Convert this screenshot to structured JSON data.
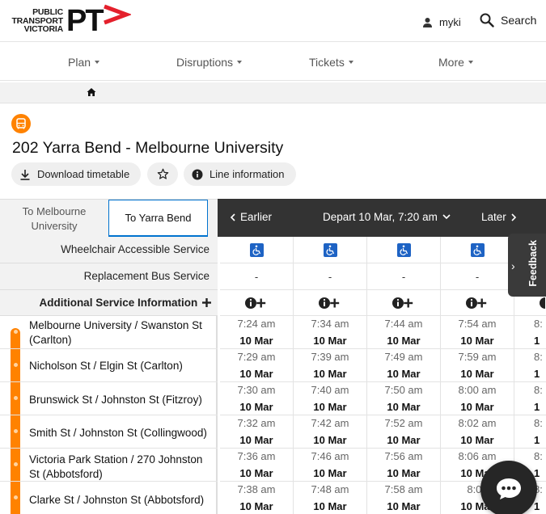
{
  "header": {
    "logo_lines": [
      "PUBLIC",
      "TRANSPORT",
      "VICTORIA"
    ],
    "logo_mark": "PT",
    "myki_label": "myki",
    "search_label": "Search"
  },
  "nav": {
    "items": [
      "Plan",
      "Disruptions",
      "Tickets",
      "More"
    ]
  },
  "route": {
    "title": "202 Yarra Bend - Melbourne University",
    "mode_icon": "bus-icon",
    "download_label": "Download timetable",
    "line_info_label": "Line information"
  },
  "timetable": {
    "directions": [
      "To Melbourne University",
      "To Yarra Bend"
    ],
    "earlier_label": "Earlier",
    "depart_label": "Depart 10 Mar, 7:20 am",
    "later_label": "Later",
    "service_rows": [
      "Wheelchair Accessible Service",
      "Replacement Bus Service",
      "Additional Service Information"
    ],
    "replacement_values": [
      "-",
      "-",
      "-",
      "-"
    ],
    "stops": [
      {
        "name": "Melbourne University / Swanston St (Carlton)",
        "times": [
          "7:24 am",
          "7:34 am",
          "7:44 am",
          "7:54 am",
          "8:"
        ]
      },
      {
        "name": "Nicholson St / Elgin St (Carlton)",
        "times": [
          "7:29 am",
          "7:39 am",
          "7:49 am",
          "7:59 am",
          "8:"
        ]
      },
      {
        "name": "Brunswick St / Johnston St (Fitzroy)",
        "times": [
          "7:30 am",
          "7:40 am",
          "7:50 am",
          "8:00 am",
          "8:"
        ]
      },
      {
        "name": "Smith St / Johnston St (Collingwood)",
        "times": [
          "7:32 am",
          "7:42 am",
          "7:52 am",
          "8:02 am",
          "8:"
        ]
      },
      {
        "name": "Victoria Park Station / 270 Johnston St (Abbotsford)",
        "times": [
          "7:36 am",
          "7:46 am",
          "7:56 am",
          "8:06 am",
          "8:"
        ]
      },
      {
        "name": "Clarke St / Johnston St (Abbotsford)",
        "times": [
          "7:38 am",
          "7:48 am",
          "7:58 am",
          "8:08",
          "8:"
        ]
      }
    ],
    "date_label": "10 Mar",
    "date_partial": "1"
  },
  "feedback_label": "Feedback",
  "colors": {
    "accent": "#ff8200",
    "brand_chevron": "#e4202c",
    "link_blue": "#0072ce",
    "dark_bar": "#333333"
  }
}
